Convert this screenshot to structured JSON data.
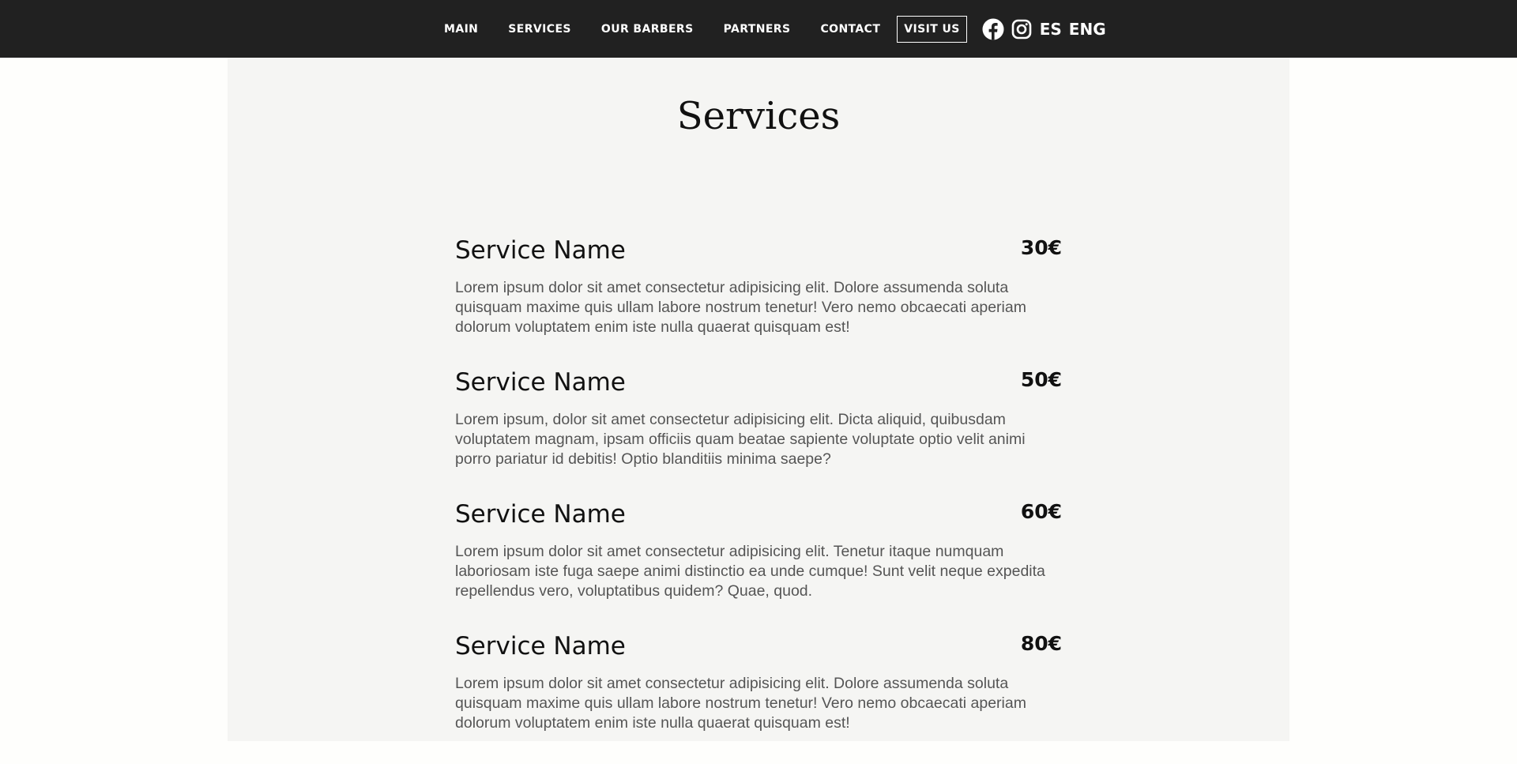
{
  "nav": {
    "items": [
      {
        "label": "MAIN"
      },
      {
        "label": "SERVICES"
      },
      {
        "label": "OUR BARBERS"
      },
      {
        "label": "PARTNERS"
      },
      {
        "label": "CONTACT"
      }
    ],
    "visit_label": "VISIT US",
    "social_icons": [
      "facebook-icon",
      "instagram-icon"
    ],
    "languages": [
      "ES",
      "ENG"
    ]
  },
  "colors": {
    "navbar_bg": "#212121",
    "page_bg": "#fefefc",
    "content_bg": "#f5f5f3",
    "text_dark": "#111111",
    "text_muted": "#555555"
  },
  "page": {
    "title": "Services"
  },
  "services": [
    {
      "name": "Service Name",
      "price": "30€",
      "description": "Lorem ipsum dolor sit amet consectetur adipisicing elit. Dolore assumenda soluta quisquam maxime quis ullam labore nostrum tenetur! Vero nemo obcaecati aperiam dolorum voluptatem enim iste nulla quaerat quisquam est!"
    },
    {
      "name": "Service Name",
      "price": "50€",
      "description": "Lorem ipsum, dolor sit amet consectetur adipisicing elit. Dicta aliquid, quibusdam voluptatem magnam, ipsam officiis quam beatae sapiente voluptate optio velit animi porro pariatur id debitis! Optio blanditiis minima saepe?"
    },
    {
      "name": "Service Name",
      "price": "60€",
      "description": "Lorem ipsum dolor sit amet consectetur adipisicing elit. Tenetur itaque numquam laboriosam iste fuga saepe animi distinctio ea unde cumque! Sunt velit neque expedita repellendus vero, voluptatibus quidem? Quae, quod."
    },
    {
      "name": "Service Name",
      "price": "80€",
      "description": "Lorem ipsum dolor sit amet consectetur adipisicing elit. Dolore assumenda soluta quisquam maxime quis ullam labore nostrum tenetur! Vero nemo obcaecati aperiam dolorum voluptatem enim iste nulla quaerat quisquam est!"
    }
  ]
}
